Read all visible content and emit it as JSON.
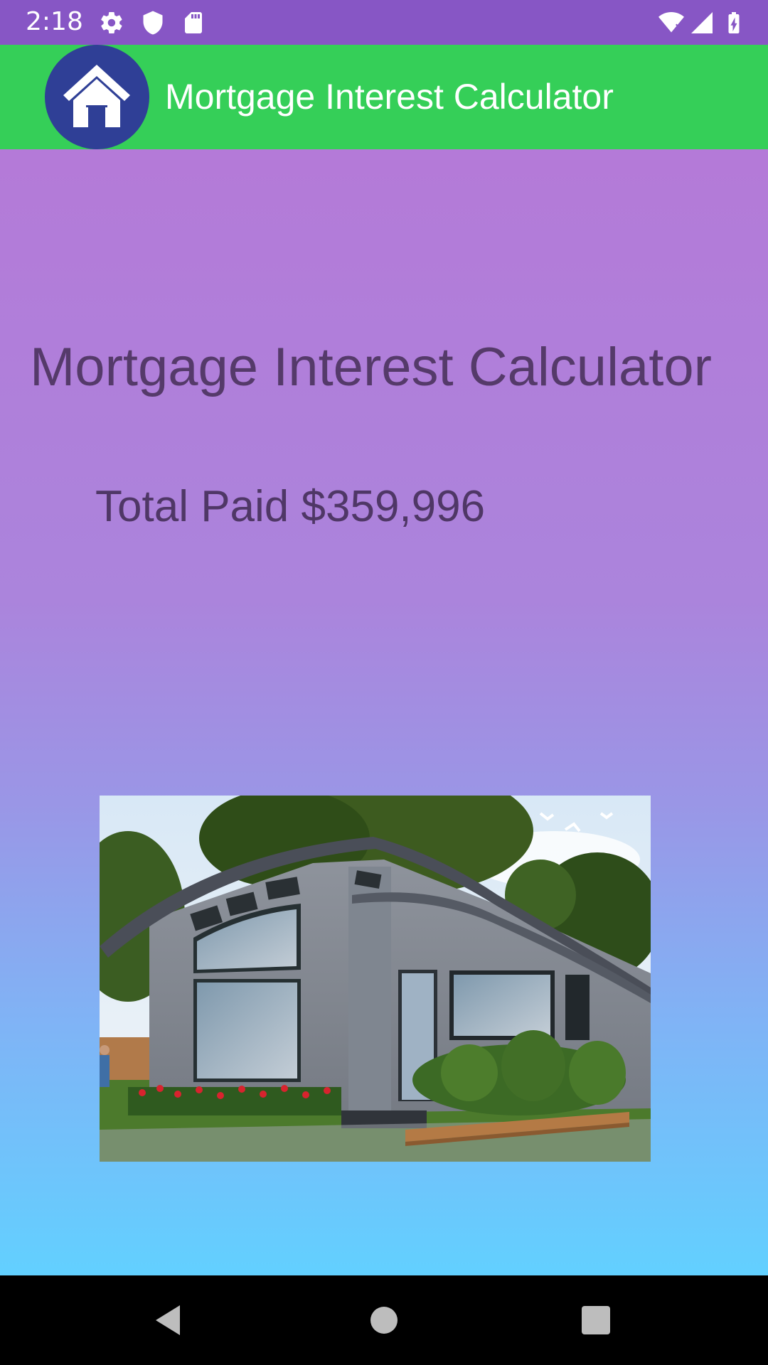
{
  "status_bar": {
    "time": "2:18",
    "icons": [
      "settings-gear-icon",
      "shield-icon",
      "sd-card-icon",
      "wifi-icon",
      "signal-icon",
      "battery-charging-icon"
    ]
  },
  "app_bar": {
    "title": "Mortgage Interest Calculator",
    "logo_icon": "home-icon",
    "colors": {
      "app_bar": "#35cf58",
      "logo_circle": "#2f3f96",
      "status_bar": "#8756c5"
    }
  },
  "main": {
    "heading": "Mortgage Interest Calculator",
    "total_paid_text": "Total Paid $359,996",
    "image_subject": "house-illustration"
  },
  "nav_bar": {
    "buttons": [
      "back-icon",
      "home-circle-icon",
      "recents-square-icon"
    ]
  }
}
